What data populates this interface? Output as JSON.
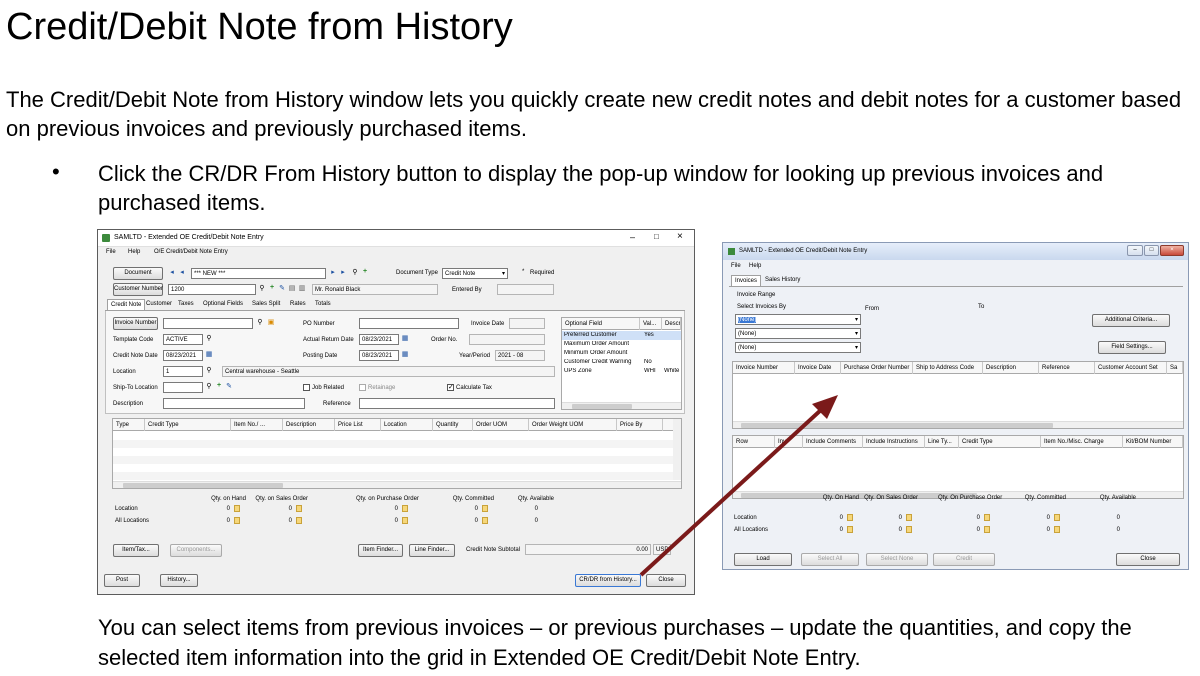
{
  "slide": {
    "title": "Credit/Debit Note from History",
    "intro": "The Credit/Debit Note from History window lets you quickly create new credit notes and debit notes for a customer based on previous invoices and previously purchased items.",
    "bullet": "Click the CR/DR From History button to display the pop-up window for looking up previous invoices and purchased items.",
    "footer": "You can select items from previous invoices – or previous purchases – update the quantities, and copy the selected item information into the grid in Extended OE Credit/Debit Note Entry."
  },
  "win1": {
    "title": "SAMLTD - Extended OE Credit/Debit Note Entry",
    "menu": [
      "File",
      "Help",
      "O/E Credit/Debit Note Entry"
    ],
    "document_btn": "Document",
    "document_value": "*** NEW ***",
    "document_type_label": "Document Type",
    "document_type_value": "Credit Note",
    "required_label": "Required",
    "customer_btn": "Customer Number",
    "customer_value": "1200",
    "customer_name": "Mr. Ronald Black",
    "entered_by_label": "Entered By",
    "tabs": [
      "Credit Note",
      "Customer",
      "Taxes",
      "Optional Fields",
      "Sales Split",
      "Rates",
      "Totals"
    ],
    "invoice_btn": "Invoice Number",
    "po_label": "PO Number",
    "invoice_date_label": "Invoice Date",
    "template_label": "Template Code",
    "template_value": "ACTIVE",
    "return_date_label": "Actual Return Date",
    "return_date_value": "08/23/2021",
    "order_no_label": "Order No.",
    "cn_date_label": "Credit Note Date",
    "cn_date_value": "08/23/2021",
    "posting_date_label": "Posting Date",
    "posting_date_value": "08/23/2021",
    "year_period_label": "Year/Period",
    "year_period_value": "2021 - 08",
    "location_label": "Location",
    "location_value": "1",
    "location_desc": "Central warehouse - Seattle",
    "shipto_label": "Ship-To Location",
    "job_related_label": "Job Related",
    "retainage_label": "Retainage",
    "calc_tax_label": "Calculate Tax",
    "description_label": "Description",
    "reference_label": "Reference",
    "opt_headers": [
      "Optional Field",
      "Val...",
      "Descri"
    ],
    "opt_rows": [
      [
        "Preferred Customer",
        "Yes",
        ""
      ],
      [
        "Maximum Order Amount",
        "",
        ""
      ],
      [
        "Minimum Order Amount",
        "",
        ""
      ],
      [
        "Customer Credit Warning",
        "No",
        ""
      ],
      [
        "UPS Zone",
        "WHI",
        "White"
      ]
    ],
    "grid_headers": [
      "Type",
      "Credit Type",
      "Item No./ ...",
      "Description",
      "Price List",
      "Location",
      "Quantity",
      "Order UOM",
      "Order Weight UOM",
      "Price By"
    ],
    "qty_headers": [
      "Qty. on Hand",
      "Qty. on Sales Order",
      "Qty. on Purchase Order",
      "Qty. Committed",
      "Qty. Available"
    ],
    "qty_rows": [
      {
        "label": "Location",
        "values": [
          "0",
          "0",
          "0",
          "0",
          "0"
        ]
      },
      {
        "label": "All Locations",
        "values": [
          "0",
          "0",
          "0",
          "0",
          "0"
        ]
      }
    ],
    "item_tax_btn": "Item/Tax...",
    "components_btn": "Components...",
    "item_finder_btn": "Item Finder...",
    "line_finder_btn": "Line Finder...",
    "subtotal_label": "Credit Note Subtotal",
    "subtotal_value": "0.00",
    "currency": "USD",
    "post_btn": "Post",
    "history_btn": "History...",
    "crdr_btn": "CR/DR from History...",
    "close_btn": "Close"
  },
  "win2": {
    "title": "SAMLTD - Extended OE Credit/Debit Note Entry",
    "menu": [
      "File",
      "Help"
    ],
    "tabs": [
      "Invoices",
      "Sales History"
    ],
    "invoice_range_label": "Invoice Range",
    "select_by_label": "Select Invoices By",
    "from_label": "From",
    "to_label": "To",
    "select_values": [
      "(None)",
      "(None)",
      "(None)"
    ],
    "additional_criteria_btn": "Additional Criteria...",
    "field_settings_btn": "Field Settings...",
    "grid1_headers": [
      "Invoice Number",
      "Invoice Date",
      "Purchase Order Number",
      "Ship to Address Code",
      "Description",
      "Reference",
      "Customer Account Set",
      "Sa"
    ],
    "grid2_headers": [
      "Row",
      "Inv",
      "Include Comments",
      "Include Instructions",
      "Line Ty...",
      "Credit Type",
      "Item No./Misc. Charge",
      "Kit/BOM Number"
    ],
    "qty_headers": [
      "Qty. On Hand",
      "Qty. On Sales Order",
      "Qty. On Purchase Order",
      "Qty. Committed",
      "Qty. Available"
    ],
    "qty_rows": [
      {
        "label": "Location",
        "values": [
          "0",
          "0",
          "0",
          "0",
          "0"
        ]
      },
      {
        "label": "All Locations",
        "values": [
          "0",
          "0",
          "0",
          "0",
          "0"
        ]
      }
    ],
    "load_btn": "Load",
    "select_all_btn": "Select All",
    "select_none_btn": "Select None",
    "credit_btn": "Credit",
    "close_btn": "Close"
  },
  "colors": {
    "arrow": "#7b1a1a",
    "selection": "#3a78d4"
  }
}
